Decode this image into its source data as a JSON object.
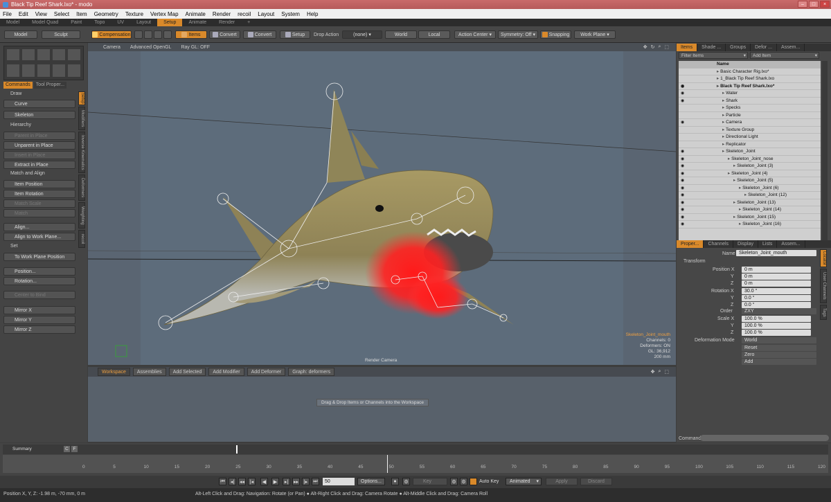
{
  "window": {
    "title": "Black Tip Reef Shark.lxo* - modo"
  },
  "menu": [
    "File",
    "Edit",
    "View",
    "Select",
    "Item",
    "Geometry",
    "Texture",
    "Vertex Map",
    "Animate",
    "Render",
    "recoil",
    "Layout",
    "System",
    "Help"
  ],
  "layout_tabs": [
    "Model",
    "Model Quad",
    "Paint",
    "Topo",
    "UV",
    "Layout",
    "Setup",
    "Animate",
    "Render",
    "+"
  ],
  "layout_active": "Setup",
  "toolbar": {
    "model": "Model",
    "sculpt": "Sculpt",
    "compensation": "Compensation",
    "items": "Items",
    "convert1": "Convert",
    "convert2": "Convert",
    "setup": "Setup",
    "drop_action_label": "Drop Action",
    "drop_action_value": "(none)",
    "world": "World",
    "local": "Local",
    "action_center": "Action Center",
    "symmetry": "Symmetry: Off",
    "snapping": "Snapping",
    "work_plane": "Work Plane"
  },
  "left": {
    "tabs": [
      "Commands",
      "Tool Proper..."
    ],
    "vtabs": [
      "Setup",
      "Modifiers",
      "Inverse Kinematics",
      "Deformers",
      "Weighting",
      "recoil"
    ],
    "sections": {
      "draw": "Draw",
      "hierarchy": "Hierarchy",
      "match": "Match and Align",
      "set": "Set"
    },
    "buttons": {
      "curve": "Curve",
      "skeleton": "Skeleton",
      "parent": "Parent in Place",
      "unparent": "Unparent in Place",
      "insert": "Insert in Place",
      "extract": "Extract in Place",
      "item_position": "Item Position",
      "item_rotation": "Item Rotation",
      "match_scale": "Match Scale",
      "match": "Match",
      "align": "Align...",
      "align_wp": "Align to Work Plane...",
      "to_wp": "To Work Plane Position",
      "position": "Position...",
      "rotation": "Rotation...",
      "center_to_bind": "Center to Bind",
      "mirror_x": "Mirror X",
      "mirror_y": "Mirror Y",
      "mirror_z": "Mirror Z"
    }
  },
  "viewport": {
    "camera": "Camera",
    "shading": "Advanced OpenGL",
    "raygl": "Ray GL: OFF",
    "selected": "Skeleton_Joint_mouth",
    "channels": "Channels: 0",
    "deformers": "Deformers: ON",
    "gl": "GL: 36,912",
    "size": "200 mm",
    "footer": "Render Camera"
  },
  "workspace": {
    "tabs": [
      "Workspace",
      "Assemblies",
      "Add Selected",
      "Add Modifier",
      "Add Deformer",
      "Graph: deformers"
    ],
    "hint": "Drag & Drop Items or Channels into the Workspace"
  },
  "items_panel": {
    "tabs": [
      "Items",
      "Shade ...",
      "Groups",
      "Defor ...",
      "Assem..."
    ],
    "filter": "Filter Items",
    "add_item": "Add Item",
    "name_col": "Name",
    "rows": [
      {
        "label": "Basic Character Rig.lxo*",
        "indent": 0,
        "eye": false
      },
      {
        "label": "1_Black Tip Reef Shark.lxo",
        "indent": 0,
        "eye": false
      },
      {
        "label": "Black Tip Reef Shark.lxo*",
        "indent": 0,
        "eye": true,
        "bold": true
      },
      {
        "label": "Water",
        "indent": 1,
        "eye": true
      },
      {
        "label": "Shark",
        "indent": 1,
        "eye": true
      },
      {
        "label": "Specks",
        "indent": 1,
        "eye": false
      },
      {
        "label": "Particle",
        "indent": 1,
        "eye": false
      },
      {
        "label": "Camera",
        "indent": 1,
        "eye": true
      },
      {
        "label": "Texture Group",
        "indent": 1,
        "eye": false
      },
      {
        "label": "Directional Light",
        "indent": 1,
        "eye": false
      },
      {
        "label": "Replicator",
        "indent": 1,
        "eye": false
      },
      {
        "label": "Skeleton_Joint",
        "indent": 1,
        "eye": true
      },
      {
        "label": "Skeleton_Joint_nose",
        "indent": 2,
        "eye": true
      },
      {
        "label": "Skeleton_Joint (3)",
        "indent": 3,
        "eye": true
      },
      {
        "label": "Skeleton_Joint (4)",
        "indent": 2,
        "eye": true
      },
      {
        "label": "Skeleton_Joint (5)",
        "indent": 3,
        "eye": true
      },
      {
        "label": "Skeleton_Joint (6)",
        "indent": 4,
        "eye": true
      },
      {
        "label": "Skeleton_Joint (12)",
        "indent": 5,
        "eye": true
      },
      {
        "label": "Skeleton_Joint (13)",
        "indent": 3,
        "eye": true
      },
      {
        "label": "Skeleton_Joint (14)",
        "indent": 4,
        "eye": true
      },
      {
        "label": "Skeleton_Joint (15)",
        "indent": 3,
        "eye": true
      },
      {
        "label": "Skeleton_Joint (16)",
        "indent": 4,
        "eye": true
      }
    ]
  },
  "properties": {
    "tabs": [
      "Proper...",
      "Channels",
      "Display",
      "Lists",
      "Assem..."
    ],
    "vtabs": [
      "Locator",
      "User Channels",
      "Tags"
    ],
    "name_label": "Name",
    "name_value": "Skeleton_Joint_mouth",
    "transform": "Transform",
    "pos_label": "Position X",
    "rot_label": "Rotation X",
    "scale_label": "Scale X",
    "y": "Y",
    "z": "Z",
    "order_label": "Order",
    "order_value": "ZXY",
    "pos": [
      "0 m",
      "0 m",
      "0 m"
    ],
    "rot": [
      "30.0 °",
      "0.0 °",
      "0.0 °"
    ],
    "scale": [
      "100.0 %",
      "100.0 %",
      "100.0 %"
    ],
    "deform_label": "Deformation Mode",
    "deform_value": "World",
    "reset": "Reset",
    "zero": "Zero",
    "add": "Add",
    "command": "Command"
  },
  "timeline": {
    "summary": "Summary",
    "c": "C",
    "f": "F",
    "ticks": [
      "0",
      "5",
      "10",
      "15",
      "20",
      "25",
      "30",
      "35",
      "40",
      "45",
      "50",
      "55",
      "60",
      "65",
      "70",
      "75",
      "80",
      "85",
      "90",
      "95",
      "100",
      "105",
      "110",
      "115",
      "120"
    ],
    "current_frame_tick": "50"
  },
  "transport": {
    "frame": "50",
    "options": "Options...",
    "key": "Key",
    "auto_key": "Auto Key",
    "animated": "Animated",
    "apply": "Apply",
    "discard": "Discard"
  },
  "status": {
    "position": "Position X, Y, Z:   -1.98 m, -70 mm, 0 m",
    "hint": "Alt-Left Click and Drag: Navigation: Rotate (or Pan) ● Alt-Right Click and Drag: Camera Rotate ● Alt-Middle Click and Drag: Camera Roll"
  }
}
